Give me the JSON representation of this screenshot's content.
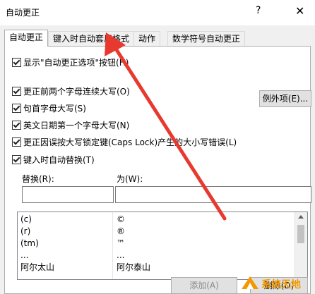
{
  "window": {
    "title": "自动更正",
    "help_label": "?",
    "close_label": "✕"
  },
  "tabs": [
    {
      "label": "自动更正"
    },
    {
      "label": "键入时自动套用格式"
    },
    {
      "label": "动作"
    },
    {
      "label": "数学符号自动更正"
    }
  ],
  "options": {
    "show_buttons": "显示\"自动更正选项\"按钮(H)",
    "two_initials": "更正前两个字母连续大写(O)",
    "capitalize_sentence": "句首字母大写(S)",
    "capitalize_days": "英文日期第一个字母大写(N)",
    "caps_lock": "更正因误按大写锁定键(Caps Lock)产生的大小写错误(L)",
    "replace_as_type": "键入时自动替换(T)"
  },
  "exceptions_button": "例外项(E)...",
  "replace_label": "替换(R):",
  "with_label": "为(W):",
  "replace_value": "",
  "with_value": "",
  "entries": [
    {
      "from": "(c)",
      "to": "©"
    },
    {
      "from": "(r)",
      "to": "®"
    },
    {
      "from": "(tm)",
      "to": "™"
    },
    {
      "from": "...",
      "to": "..."
    },
    {
      "from": "阿尔太山",
      "to": "阿尔泰山"
    }
  ],
  "add_button": "添加(A)",
  "delete_button": "删除(D)",
  "watermark": "系统天地",
  "colors": {
    "annotation_arrow": "#e8392f",
    "watermark_orange": "#f39800"
  },
  "icons": {
    "checkbox": "checkmark",
    "watermark_logo": "system-logo"
  }
}
